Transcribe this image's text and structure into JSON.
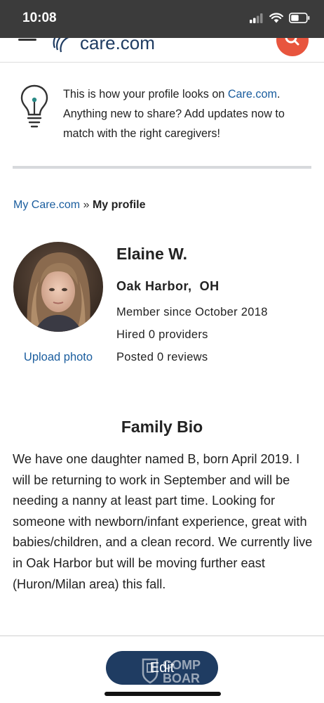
{
  "status_bar": {
    "time": "10:08",
    "icons": [
      "cellular-signal-icon",
      "wifi-icon",
      "battery-icon"
    ]
  },
  "header": {
    "logo_text": "care.com",
    "icons": [
      "menu-icon",
      "search-icon"
    ],
    "accent_color": "#e8553e"
  },
  "tip": {
    "icon": "lightbulb-icon",
    "text_before_link": "This is how your profile looks on ",
    "link_text": "Care.com",
    "text_after_link": ". Anything new to share? Add updates now to match with the right caregivers!"
  },
  "breadcrumb": {
    "parent": "My Care.com",
    "separator": "»",
    "current": "My profile"
  },
  "profile": {
    "name": "Elaine W.",
    "city": "Oak Harbor,",
    "state": "OH",
    "member_since": "Member since October 2018",
    "hired": "Hired 0 providers",
    "reviews": "Posted 0 reviews",
    "upload_photo": "Upload photo"
  },
  "family_bio": {
    "title": "Family Bio",
    "text": "We have one daughter named B, born April 2019. I will be returning to work in September and will be needing a nanny at least part time. Looking for someone with newborn/infant experience, great with babies/children, and a clean record. We currently live in Oak Harbor but will be moving further east (Huron/Milan area) this fall."
  },
  "footer": {
    "edit_label": "Edit",
    "button_color": "#1f3c62"
  },
  "colors": {
    "link": "#1a5d9e",
    "status_bar": "#3b3b3b"
  }
}
